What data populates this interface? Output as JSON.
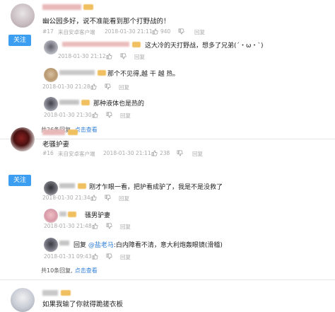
{
  "comments": [
    {
      "floor": "#17",
      "text": "幽公园多好，说不准能看到那个打野战的！",
      "source": "来自安卓客户端",
      "time": "2018-01-30 21:11",
      "likes": "940",
      "follow_label": "关注",
      "reply_label": "回复",
      "replies": [
        {
          "text": "这大冷的天打野战，想多了兄弟(´・ω・`)",
          "time": "2018-01-30 21:12",
          "reply_label": "回复"
        },
        {
          "text": "那个不见得,越 干 越 热。",
          "time": "2018-01-30 21:28",
          "reply_label": "回复"
        },
        {
          "text": "那种液体也是热的",
          "time": "2018-01-30 21:30",
          "reply_label": "回复"
        }
      ],
      "more_count_text": "共26条回复,",
      "more_link": "点击查看"
    },
    {
      "floor": "#16",
      "text": "老骚护妻",
      "source": "来自安卓客户端",
      "time": "2018-01-30 21:11",
      "likes": "238",
      "follow_label": "关注",
      "reply_label": "回复",
      "replies": [
        {
          "text": "刚才乍眼一看，把护看成驴了，我是不是没救了",
          "time": "2018-01-30 21:34",
          "reply_label": "回复"
        },
        {
          "text": "骚男驴妻",
          "time": "2018-01-30 21:48",
          "reply_label": "回复"
        },
        {
          "prefix": "回复 ",
          "mention": "@盐老马",
          "suffix": ":白内障看不清，意大利炮轰眼镜(滑稽)",
          "time": "2018-01-31 09:43",
          "reply_label": "回复"
        }
      ],
      "more_count_text": "共10条回复,",
      "more_link": "点击查看"
    },
    {
      "text": "如果我输了你就得跪搓衣板"
    }
  ]
}
